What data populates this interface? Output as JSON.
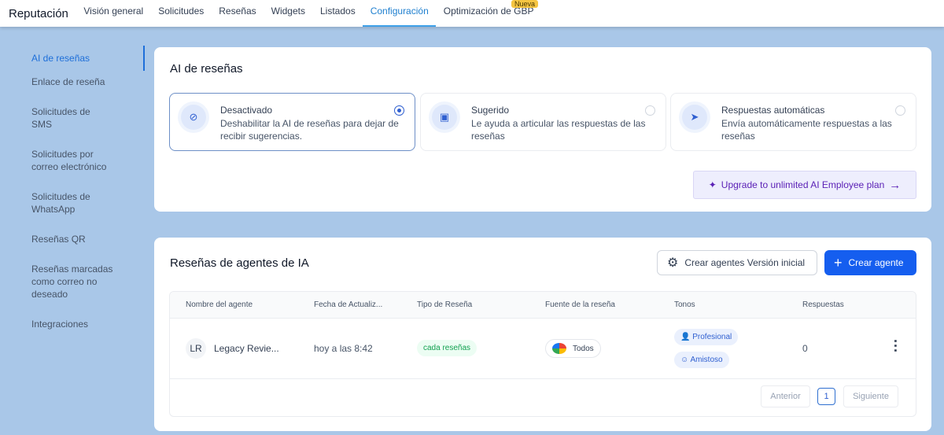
{
  "topnav": {
    "brand": "Reputación",
    "items": [
      "Visión general",
      "Solicitudes",
      "Reseñas",
      "Widgets",
      "Listados",
      "Configuración",
      "Optimización de GBP"
    ],
    "badge": "Nueva"
  },
  "sidebar": [
    "AI de reseñas",
    "Enlace de reseña",
    "Solicitudes de SMS",
    "Solicitudes por correo electrónico",
    "Solicitudes de WhatsApp",
    "Reseñas QR",
    "Reseñas marcadas como correo no deseado",
    "Integraciones"
  ],
  "ai": {
    "title": "AI de reseñas",
    "options": [
      {
        "title": "Desactivado",
        "desc": "Deshabilitar la AI de reseñas para dejar de recibir sugerencias."
      },
      {
        "title": "Sugerido",
        "desc": "Le ayuda a articular las respuestas de las reseñas"
      },
      {
        "title": "Respuestas automáticas",
        "desc": "Envía automáticamente respuestas a las reseñas"
      }
    ],
    "upgrade": "Upgrade to unlimited AI Employee plan"
  },
  "agents": {
    "title": "Reseñas de agentes de IA",
    "btn_initial": "Crear agentes Versión inicial",
    "btn_create": "Crear agente",
    "columns": [
      "Nombre del agente",
      "Fecha de Actualiz...",
      "Tipo de Reseña",
      "Fuente de la reseña",
      "Tonos",
      "Respuestas"
    ],
    "row": {
      "initials": "LR",
      "name": "Legacy Revie...",
      "date": "hoy a las 8:42",
      "type": "cada reseñas",
      "source": "Todos",
      "tones": [
        "Profesional",
        "Amistoso"
      ],
      "responses": "0"
    },
    "pagination": {
      "prev": "Anterior",
      "page": "1",
      "next": "Siguiente"
    }
  }
}
